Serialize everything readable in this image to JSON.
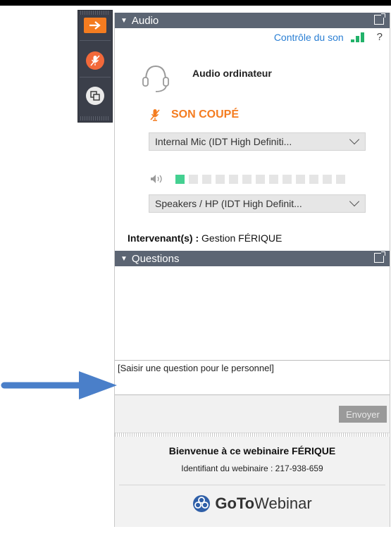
{
  "audio": {
    "header_label": "Audio",
    "sound_control_label": "Contrôle du son",
    "help_label": "?",
    "title": "Audio ordinateur",
    "muted_label": "SON COUPÉ",
    "mic_select_value": "Internal Mic  (IDT High Definiti...",
    "speaker_select_value": "Speakers / HP (IDT High Definit...",
    "meter_level": 1,
    "meter_segments": 13
  },
  "presenter": {
    "label": "Intervenant(s) :",
    "name": "Gestion FÉRIQUE"
  },
  "questions": {
    "header_label": "Questions",
    "input_placeholder": "[Saisir une question pour le personnel]",
    "send_label": "Envoyer"
  },
  "welcome": {
    "title": "Bienvenue à ce webinaire FÉRIQUE",
    "webinar_id": "Identifiant du webinaire : 217-938-659",
    "logo_bold": "GoTo",
    "logo_regular": "Webinar"
  },
  "colors": {
    "accent_orange": "#f47c20",
    "header_gray": "#5c6573",
    "link_blue": "#2a7fd4",
    "meter_green": "#44d091",
    "annotation_arrow": "#4a7fc9"
  },
  "icons": [
    "arrow-right-icon",
    "muted-mic-icon",
    "screen-share-icon",
    "headset-icon",
    "speaker-icon",
    "popout-icon",
    "signal-bars-icon",
    "gotowebinar-logo-icon"
  ]
}
